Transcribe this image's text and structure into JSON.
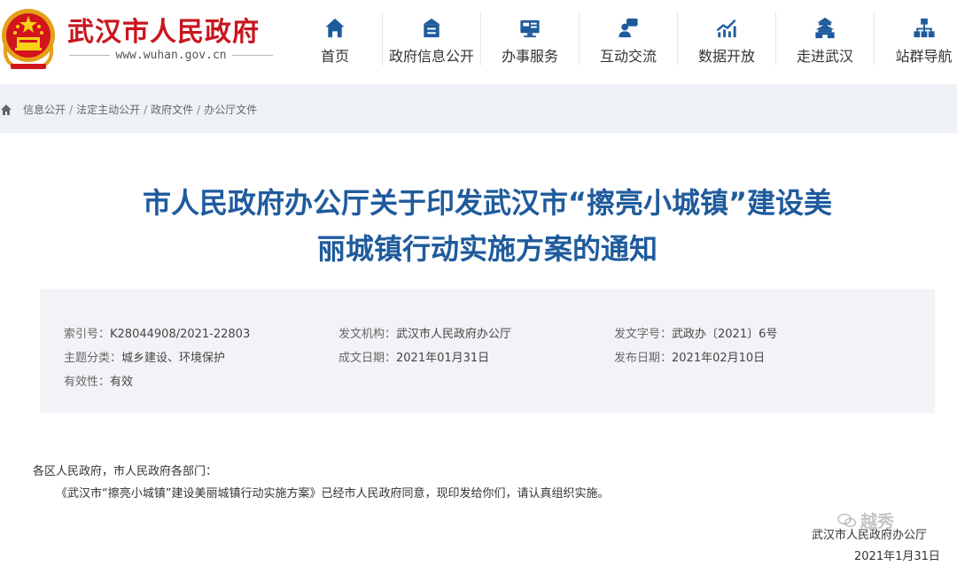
{
  "header": {
    "site_name": "武汉市人民政府",
    "site_url": "www.wuhan.gov.cn",
    "nav": [
      {
        "label": "首页",
        "icon": "home-icon"
      },
      {
        "label": "政府信息公开",
        "icon": "info-disclosure-icon"
      },
      {
        "label": "办事服务",
        "icon": "service-icon"
      },
      {
        "label": "互动交流",
        "icon": "interaction-icon"
      },
      {
        "label": "数据开放",
        "icon": "data-chart-icon"
      },
      {
        "label": "走进武汉",
        "icon": "tower-icon"
      },
      {
        "label": "站群导航",
        "icon": "site-tree-icon"
      }
    ]
  },
  "breadcrumb": [
    "信息公开",
    "法定主动公开",
    "政府文件",
    "办公厅文件"
  ],
  "title_line1": "市人民政府办公厅关于印发武汉市“擦亮小城镇”建设美",
  "title_line2": "丽城镇行动实施方案的通知",
  "meta": {
    "index_label": "索引号：",
    "index_value": "K28044908/2021-22803",
    "issuer_label": "发文机构：",
    "issuer_value": "武汉市人民政府办公厅",
    "doc_no_label": "发文字号：",
    "doc_no_value": "武政办〔2021〕6号",
    "topic_label": "主题分类：",
    "topic_value": "城乡建设、环境保护",
    "written_label": "成文日期：",
    "written_value": "2021年01月31日",
    "publish_label": "发布日期：",
    "publish_value": "2021年02月10日",
    "validity_label": "有效性：",
    "validity_value": "有效"
  },
  "body": {
    "greeting": "各区人民政府，市人民政府各部门：",
    "paragraph": "《武汉市“擦亮小城镇”建设美丽城镇行动实施方案》已经市人民政府同意，现印发给你们，请认真组织实施。"
  },
  "signature": {
    "org": "武汉市人民政府办公厅",
    "date": "2021年1月31日"
  },
  "watermark": "越秀",
  "colors": {
    "brand_red": "#c8161e",
    "title_blue": "#1f5b9c",
    "nav_icon": "#1f5b9c",
    "crumb_bg": "#eef1f5",
    "meta_bg": "#f1f3f6"
  }
}
